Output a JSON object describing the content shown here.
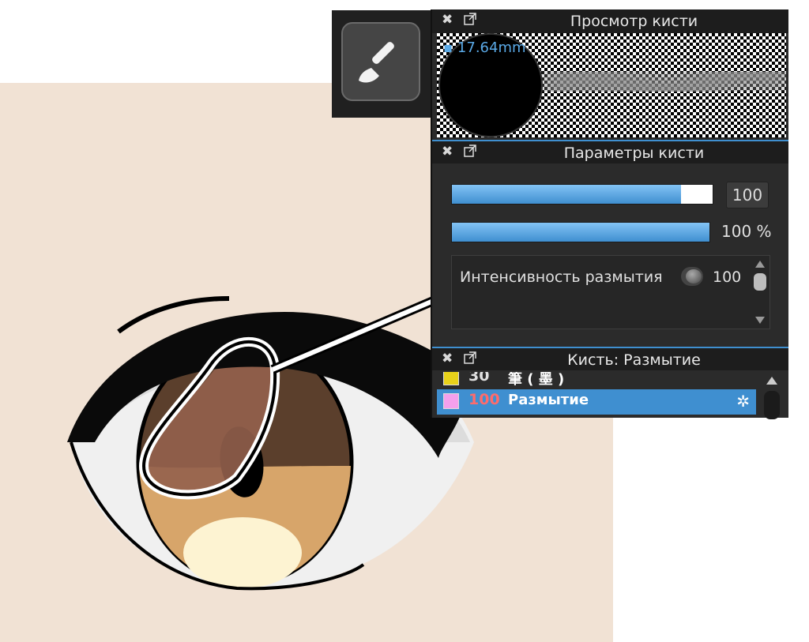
{
  "panels": {
    "preview": {
      "title": "Просмотр кисти",
      "size": "17.64mm"
    },
    "params": {
      "title": "Параметры кисти",
      "size_value": "100",
      "opacity_value": "100 %",
      "blur_label": "Интенсивность размытия",
      "blur_value": "100",
      "size_fill": 0.88,
      "opacity_fill": 1.0
    },
    "brush": {
      "title": "Кисть: Размытие",
      "items": [
        {
          "size": "30",
          "name": "筆 ( 墨 )",
          "swatch": "#e8d21a",
          "selected": false
        },
        {
          "size": "100",
          "name": "Размытие",
          "swatch": "#f4a0ec",
          "selected": true
        }
      ]
    }
  },
  "icons": {
    "close": "✖",
    "popout": "popout-icon",
    "gear": "✲",
    "brush_tool": "brush-tool-icon"
  },
  "colors": {
    "accent": "#3f8fd0",
    "canvas_bg": "#f1e2d4",
    "selected_size": "#ff6b6b"
  }
}
